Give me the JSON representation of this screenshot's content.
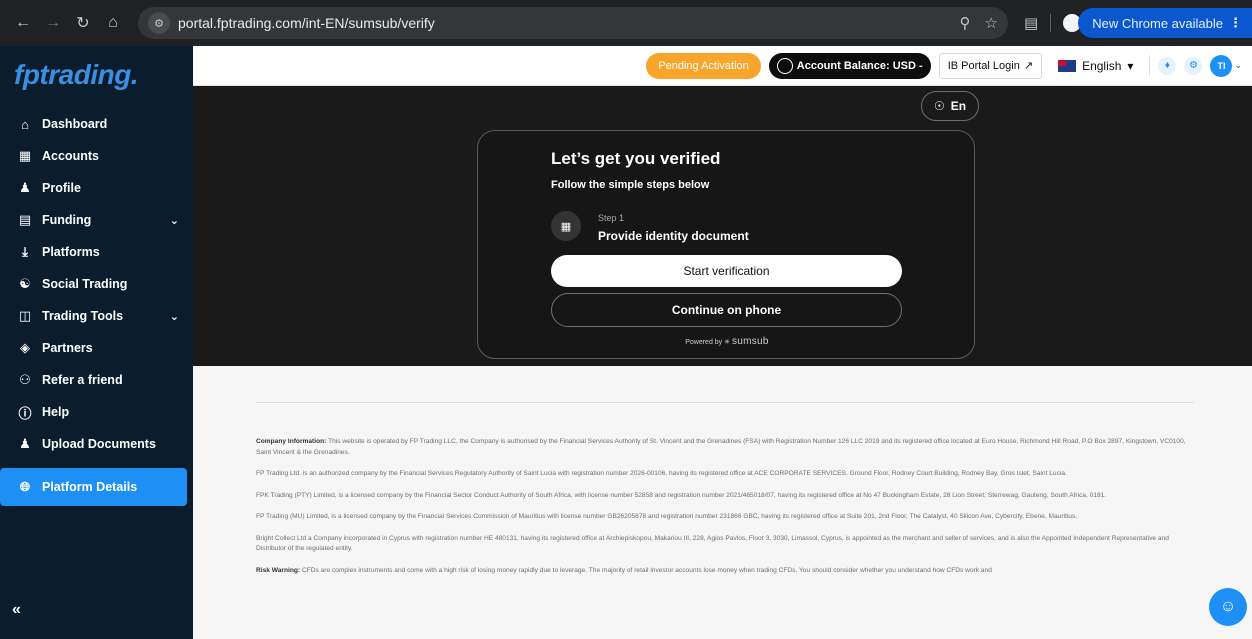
{
  "browser": {
    "url": "portal.fptrading.com/int-EN/sumsub/verify",
    "update_label": "New Chrome available"
  },
  "sidebar": {
    "logo": "fptrading.",
    "items": [
      {
        "label": "Dashboard",
        "icon": "home-icon"
      },
      {
        "label": "Accounts",
        "icon": "accounts-icon"
      },
      {
        "label": "Profile",
        "icon": "profile-icon"
      },
      {
        "label": "Funding",
        "icon": "funding-icon",
        "expandable": true
      },
      {
        "label": "Platforms",
        "icon": "download-icon"
      },
      {
        "label": "Social Trading",
        "icon": "social-trading-icon"
      },
      {
        "label": "Trading Tools",
        "icon": "trading-tools-icon",
        "expandable": true
      },
      {
        "label": "Partners",
        "icon": "partners-icon"
      },
      {
        "label": "Refer a friend",
        "icon": "refer-icon"
      },
      {
        "label": "Help",
        "icon": "help-icon"
      },
      {
        "label": "Upload Documents",
        "icon": "upload-documents-icon"
      },
      {
        "label": "Platform Details",
        "icon": "globe-icon",
        "active": true
      }
    ],
    "collapse_label": "«"
  },
  "header": {
    "pending": "Pending Activation",
    "balance": "Account Balance: USD -",
    "ib_login": "IB Portal Login",
    "language": "English",
    "avatar": "TI"
  },
  "verify": {
    "lang_button": "En",
    "title": "Let’s get you verified",
    "subtitle": "Follow the simple steps below",
    "step_number": "Step 1",
    "step_title": "Provide identity document",
    "start_button": "Start verification",
    "phone_button": "Continue on phone",
    "powered_prefix": "Powered by",
    "powered_brand": "sumsub"
  },
  "footer": {
    "company_heading": "Company Information:",
    "company_text": "This website is operated by FP Trading LLC, the Company is authorised by the Financial Services Authority of St. Vincent and the Grenadines (FSA) with Registration Number 126 LLC 2019 and its registered office located at Euro House, Richmond Hill Road, P.O Box 2897, Kingstown, VC0100, Saint Vincent & the Grenadines.",
    "p2": "FP Trading Ltd. is an authorized company by the Financial Services Regulatory Authority of Saint Lucia with registration number 2026-00106, having its registered office at ACE CORPORATE SERVICES, Ground Floor, Rodney Court Building, Rodney Bay, Gros Islet, Saint Lucia.",
    "p3": "FPK Trading (PTY) Limited, is a licensed company by the Financial Sector Conduct Authority of South Africa, with license number 52858 and registration number 2021/465018/07, having its registered office at No 47 Buckingham Estate, 28 Lion Street, Sterrewag, Gauteng, South Africa, 0181.",
    "p4": "FP Trading (MU) Limited, is a licensed company by the Financial Services Commission of Mauritius with license number GB26205878 and registration number 231866 GBC, having its registered office at Suite 201, 2nd Floor, The Catalyst, 40 Silicon Ave, Cybercity, Ebene, Mauritius.",
    "p5": "Bright Collect Ltd a Company incorporated in Cyprus with registration number HE 480131, having its registered office at Archiepiskopou, Makariou III, 228, Agios Pavlos, Floor 3, 3030, Limassol, Cyprus, is appointed as the merchant and seller of services, and is also the Appointed Independent Representative and Distributor of the regulated entity.",
    "risk_heading": "Risk Warning:",
    "risk_text": "CFDs are complex instruments and come with a high risk of losing money rapidly due to leverage. The majority of retail investor accounts lose money when trading CFDs. You should consider whether you understand how CFDs work and"
  }
}
